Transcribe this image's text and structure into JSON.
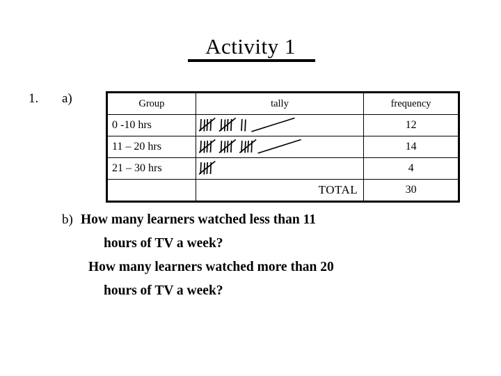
{
  "slide": {
    "title": "Activity 1",
    "question_number": "1.",
    "part_a_label": "a)",
    "part_b_label": "b)"
  },
  "table": {
    "headers": {
      "group": "Group",
      "tally": "tally",
      "frequency": "frequency"
    },
    "rows": [
      {
        "group": "0 -10 hrs",
        "tally_count": 12,
        "tally_groups": [
          4,
          4,
          2
        ],
        "frequency": "12"
      },
      {
        "group": "11 – 20 hrs",
        "tally_count": 14,
        "tally_groups": [
          4,
          4,
          4
        ],
        "frequency": "14"
      },
      {
        "group": "21 – 30 hrs",
        "tally_count": 4,
        "tally_groups": [
          4
        ],
        "frequency": "4"
      }
    ],
    "total_row": {
      "group": "",
      "label": "TOTAL",
      "frequency": "30"
    }
  },
  "questions": {
    "b_lines": [
      "How many learners watched less than 11",
      "hours of TV a week?",
      "How many learners watched more than 20",
      "hours of TV a week?"
    ]
  },
  "chart_data": {
    "type": "table",
    "title": "Activity 1",
    "columns": [
      "Group",
      "tally",
      "frequency"
    ],
    "categories": [
      "0 -10 hrs",
      "11 – 20 hrs",
      "21 – 30 hrs"
    ],
    "values": [
      12,
      14,
      4
    ],
    "total": 30,
    "xlabel": "Group",
    "ylabel": "frequency"
  },
  "colors": {
    "ink": "#000000",
    "page": "#ffffff"
  }
}
